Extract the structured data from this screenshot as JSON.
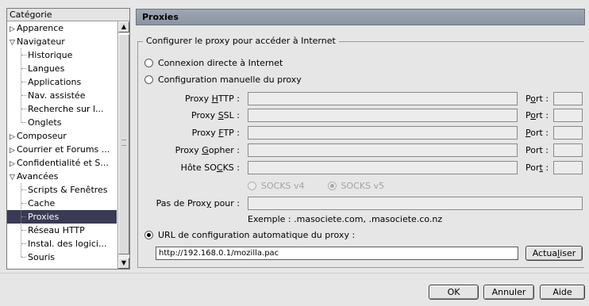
{
  "tree": {
    "header": "Catégorie",
    "items": [
      {
        "label": "Apparence",
        "icon": "triangle-right",
        "indent": 0
      },
      {
        "label": "Navigateur",
        "icon": "triangle-down",
        "indent": 0
      },
      {
        "label": "Historique",
        "indent": 1
      },
      {
        "label": "Langues",
        "indent": 1
      },
      {
        "label": "Applications",
        "indent": 1
      },
      {
        "label": "Nav. assistée",
        "indent": 1
      },
      {
        "label": "Recherche sur l...",
        "indent": 1
      },
      {
        "label": "Onglets",
        "indent": 1
      },
      {
        "label": "Composeur",
        "icon": "triangle-right",
        "indent": 0
      },
      {
        "label": "Courrier et Forums ...",
        "icon": "triangle-right",
        "indent": 0
      },
      {
        "label": "Confidentialité et S...",
        "icon": "triangle-right",
        "indent": 0
      },
      {
        "label": "Avancées",
        "icon": "triangle-down",
        "indent": 0
      },
      {
        "label": "Scripts & Fenêtres",
        "indent": 1
      },
      {
        "label": "Cache",
        "indent": 1
      },
      {
        "label": "Proxies",
        "indent": 1,
        "selected": true
      },
      {
        "label": "Réseau HTTP",
        "indent": 1
      },
      {
        "label": "Instal. des logici...",
        "indent": 1
      },
      {
        "label": "Souris",
        "indent": 1
      }
    ]
  },
  "panel": {
    "title": "Proxies",
    "group_legend": "Configurer le proxy pour accéder à Internet",
    "radio_direct": "Connexion directe à Internet",
    "radio_manual": "Configuration manuelle du proxy",
    "radio_auto": "URL de configuration automatique du proxy :",
    "selected_mode": "auto",
    "proxies": [
      {
        "pre": "Proxy ",
        "key": "H",
        "post": "TTP :",
        "port_key": "o",
        "port_pre": "P",
        "port_post": "rt :"
      },
      {
        "pre": "Proxy ",
        "key": "S",
        "post": "SL :",
        "port_key": "o",
        "port_pre": "P",
        "port_post": "rt :"
      },
      {
        "pre": "Proxy ",
        "key": "F",
        "post": "TP :",
        "port_key": "P",
        "port_pre": "",
        "port_post": "ort :"
      },
      {
        "pre": "Proxy ",
        "key": "G",
        "post": "opher :",
        "port_key": "",
        "port_pre": "Port :",
        "port_post": ""
      },
      {
        "pre": "Hôte SO",
        "key": "C",
        "post": "KS :",
        "port_key": "t",
        "port_pre": "Por",
        "port_post": " :"
      }
    ],
    "socks_v4": "SOCKS v4",
    "socks_v5": "SOCKS v5",
    "no_proxy_pre": "Pas de Prox",
    "no_proxy_key": "y",
    "no_proxy_post": " pour :",
    "example": "Exemple : .masociete.com, .masociete.co.nz",
    "auto_url": "http://192.168.0.1/mozilla.pac",
    "reload_pre": "Actua",
    "reload_key": "l",
    "reload_post": "iser"
  },
  "buttons": {
    "ok": "OK",
    "cancel": "Annuler",
    "help": "Aide"
  }
}
